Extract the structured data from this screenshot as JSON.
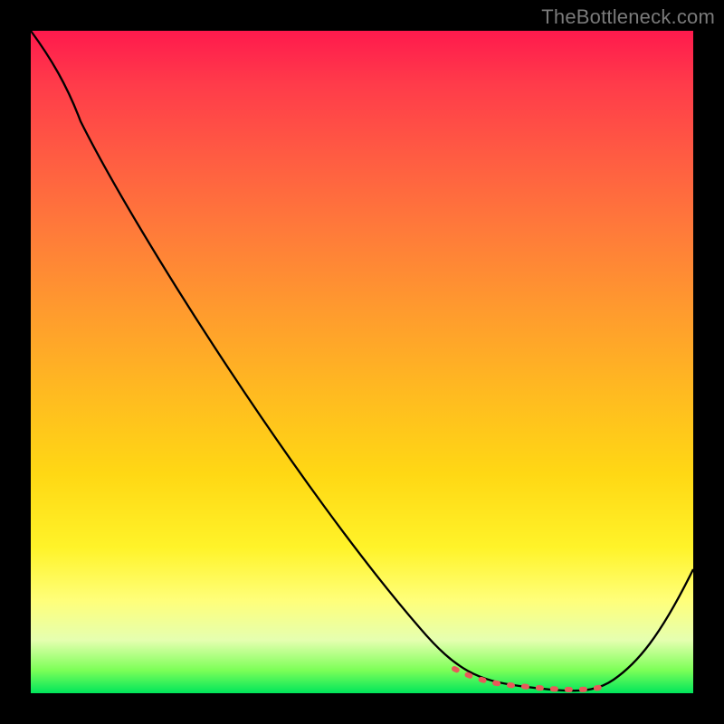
{
  "watermark": "TheBottleneck.com",
  "colors": {
    "page_bg": "#000000",
    "gradient_top": "#ff1a4d",
    "gradient_bottom": "#00e65b",
    "curve_stroke": "#000000",
    "dash_stroke": "#e85a5a",
    "watermark": "#7a7a7a"
  },
  "chart_data": {
    "type": "line",
    "title": "",
    "xlabel": "",
    "ylabel": "",
    "xlim": [
      0,
      100
    ],
    "ylim": [
      0,
      100
    ],
    "grid": false,
    "series": [
      {
        "name": "bottleneck-curve",
        "x": [
          0,
          6,
          12,
          20,
          30,
          40,
          50,
          58,
          64,
          68,
          72,
          76,
          80,
          84,
          88,
          92,
          96,
          100
        ],
        "y": [
          100,
          94,
          88,
          80.5,
          70,
          58.5,
          46,
          36,
          27,
          20,
          12.5,
          6,
          2,
          0.2,
          0.2,
          3,
          11,
          24
        ],
        "style": "solid",
        "color": "#000000"
      },
      {
        "name": "target-flat-region",
        "x": [
          64,
          68,
          72,
          76,
          80,
          84,
          86
        ],
        "y": [
          3.2,
          2.2,
          1.5,
          1.0,
          0.8,
          0.8,
          1.0
        ],
        "style": "dashed",
        "color": "#e85a5a"
      }
    ],
    "annotations": []
  }
}
